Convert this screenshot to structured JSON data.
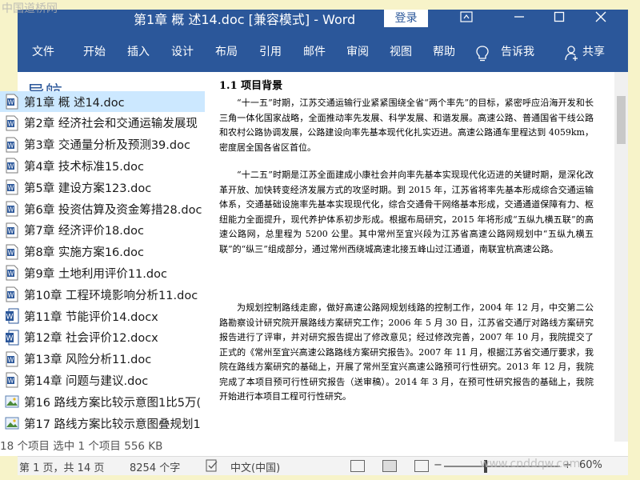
{
  "titlebar": {
    "title": "第1章 概 述14.doc [兼容模式] - Word",
    "login": "登录"
  },
  "ribbon": {
    "tabs": [
      "文件",
      "开始",
      "插入",
      "设计",
      "布局",
      "引用",
      "邮件",
      "审阅",
      "视图",
      "帮助"
    ],
    "tell_me": "告诉我",
    "share": "共享"
  },
  "nav_pane": {
    "heading": "导航"
  },
  "explorer": {
    "files": [
      {
        "name": "第1章 概 述14.doc",
        "type": "word-doc",
        "selected": true
      },
      {
        "name": "第2章 经济社会和交通运输发展现",
        "type": "word-doc",
        "selected": false
      },
      {
        "name": "第3章 交通量分析及预测39.doc",
        "type": "word-doc",
        "selected": false
      },
      {
        "name": "第4章 技术标准15.doc",
        "type": "word-doc",
        "selected": false
      },
      {
        "name": "第5章 建设方案123.doc",
        "type": "word-doc",
        "selected": false
      },
      {
        "name": "第6章 投资估算及资金筹措28.doc",
        "type": "word-doc",
        "selected": false
      },
      {
        "name": "第7章 经济评价18.doc",
        "type": "word-doc",
        "selected": false
      },
      {
        "name": "第8章 实施方案16.doc",
        "type": "word-doc",
        "selected": false
      },
      {
        "name": "第9章 土地利用评价11.doc",
        "type": "word-doc",
        "selected": false
      },
      {
        "name": "第10章  工程环境影响分析11.doc",
        "type": "word-doc",
        "selected": false
      },
      {
        "name": "第11章 节能评价14.docx",
        "type": "word-docx",
        "selected": false
      },
      {
        "name": "第12章 社会评价12.docx",
        "type": "word-docx",
        "selected": false
      },
      {
        "name": "第13章 风险分析11.doc",
        "type": "word-doc",
        "selected": false
      },
      {
        "name": "第14章 问题与建议.doc",
        "type": "word-doc",
        "selected": false
      },
      {
        "name": "第16 路线方案比较示意图1比5万(",
        "type": "image",
        "selected": false
      },
      {
        "name": "第17 路线方案比较示意图叠规划1",
        "type": "image",
        "selected": false
      }
    ],
    "status": "18 个项目    选中 1 个项目  556 KB"
  },
  "document": {
    "heading": "1.1  项目背景",
    "paragraphs": [
      "“十一五”时期，江苏交通运输行业紧紧围绕全省“两个率先”的目标，紧密呼应沿海开发和长三角一体化国家战略，全面推动率先发展、科学发展、和谐发展。高速公路、普通国省干线公路和农村公路协调发展，公路建设向率先基本现代化扎实迈进。高速公路通车里程达到 4059km，密度居全国各省区首位。",
      "“十二五”时期是江苏全面建成小康社会并向率先基本实现现代化迈进的关键时期，是深化改革开放、加快转变经济发展方式的攻坚时期。到 2015 年，江苏省将率先基本形成综合交通运输体系，交通基础设施率先基本实现现代化，综合交通骨干网络基本形成，交通通道保障有力、枢纽能力全面提升，现代养护体系初步形成。根据布局研究，2015 年将形成“五纵九横五联”的高速公路网，总里程为 5200 公里。其中常州至宜兴段为江苏省高速公路网规划中“五纵九横五联”的“纵三”组成部分，通过常州西绕城高速北接五峰山过江通道，南联宜杭高速公路。",
      "为规划控制路线走廊，做好高速公路网规划线路的控制工作，2004 年 12 月，中交第二公路勘察设计研究院开展路线方案研究工作；2006 年 5 月 30 日，江苏省交通厅对路线方案研究报告进行了评审，并对研究报告提出了修改意见；经过修改完善，2007 年 10 月，我院提交了正式的《常州至宜兴高速公路路线方案研究报告》。2007 年 11 月，根据江苏省交通厅要求，我院在路线方案研究的基础上，开展了常州至宜兴高速公路预可行性研究。2013 年 12 月，我院完成了本项目预可行性研究报告（送审稿）。2014 年 3 月，在预可性研究报告的基础上，我院开始进行本项目工程可行性研究。"
    ]
  },
  "statusbar": {
    "page": "第 1 页，共 14 页",
    "words": "8254 个字",
    "language": "中文(中国)",
    "zoom": "60%"
  },
  "watermarks": {
    "top_left": "中国道桥网",
    "bottom_right": "www.cnddqw.com"
  },
  "colors": {
    "ribbon": "#2b579a",
    "selected_row": "#cce8ff",
    "frame": "#f7f3c9"
  }
}
